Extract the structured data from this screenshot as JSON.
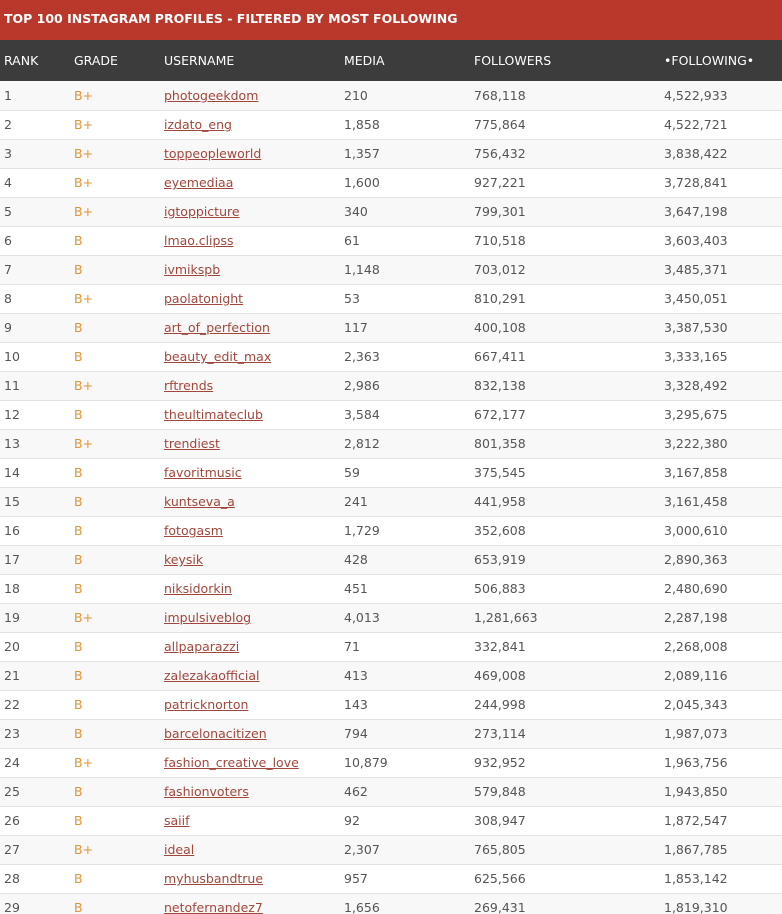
{
  "title": "TOP 100 INSTAGRAM PROFILES - FILTERED BY MOST FOLLOWING",
  "columns": {
    "rank": "RANK",
    "grade": "GRADE",
    "username": "USERNAME",
    "media": "MEDIA",
    "followers": "FOLLOWERS",
    "following": "•FOLLOWING•"
  },
  "colors": {
    "title_bar": "#b9372b",
    "header_bar": "#3c3c3c",
    "grade_text": "#e0953a",
    "username_link": "#a2473c"
  },
  "rows": [
    {
      "rank": "1",
      "grade": "B+",
      "username": "photogeekdom",
      "media": "210",
      "followers": "768,118",
      "following": "4,522,933"
    },
    {
      "rank": "2",
      "grade": "B+",
      "username": "izdato_eng",
      "media": "1,858",
      "followers": "775,864",
      "following": "4,522,721"
    },
    {
      "rank": "3",
      "grade": "B+",
      "username": "toppeopleworld",
      "media": "1,357",
      "followers": "756,432",
      "following": "3,838,422"
    },
    {
      "rank": "4",
      "grade": "B+",
      "username": "eyemediaa",
      "media": "1,600",
      "followers": "927,221",
      "following": "3,728,841"
    },
    {
      "rank": "5",
      "grade": "B+",
      "username": "igtoppicture",
      "media": "340",
      "followers": "799,301",
      "following": "3,647,198"
    },
    {
      "rank": "6",
      "grade": "B",
      "username": "lmao.clipss",
      "media": "61",
      "followers": "710,518",
      "following": "3,603,403"
    },
    {
      "rank": "7",
      "grade": "B",
      "username": "ivmikspb",
      "media": "1,148",
      "followers": "703,012",
      "following": "3,485,371"
    },
    {
      "rank": "8",
      "grade": "B+",
      "username": "paolatonight",
      "media": "53",
      "followers": "810,291",
      "following": "3,450,051"
    },
    {
      "rank": "9",
      "grade": "B",
      "username": "art_of_perfection",
      "media": "117",
      "followers": "400,108",
      "following": "3,387,530"
    },
    {
      "rank": "10",
      "grade": "B",
      "username": "beauty_edit_max",
      "media": "2,363",
      "followers": "667,411",
      "following": "3,333,165"
    },
    {
      "rank": "11",
      "grade": "B+",
      "username": "rftrends",
      "media": "2,986",
      "followers": "832,138",
      "following": "3,328,492"
    },
    {
      "rank": "12",
      "grade": "B",
      "username": "theultimateclub",
      "media": "3,584",
      "followers": "672,177",
      "following": "3,295,675"
    },
    {
      "rank": "13",
      "grade": "B+",
      "username": "trendiest",
      "media": "2,812",
      "followers": "801,358",
      "following": "3,222,380"
    },
    {
      "rank": "14",
      "grade": "B",
      "username": "favoritmusic",
      "media": "59",
      "followers": "375,545",
      "following": "3,167,858"
    },
    {
      "rank": "15",
      "grade": "B",
      "username": "kuntseva_a",
      "media": "241",
      "followers": "441,958",
      "following": "3,161,458"
    },
    {
      "rank": "16",
      "grade": "B",
      "username": "fotogasm",
      "media": "1,729",
      "followers": "352,608",
      "following": "3,000,610"
    },
    {
      "rank": "17",
      "grade": "B",
      "username": "keysik",
      "media": "428",
      "followers": "653,919",
      "following": "2,890,363"
    },
    {
      "rank": "18",
      "grade": "B",
      "username": "niksidorkin",
      "media": "451",
      "followers": "506,883",
      "following": "2,480,690"
    },
    {
      "rank": "19",
      "grade": "B+",
      "username": "impulsiveblog",
      "media": "4,013",
      "followers": "1,281,663",
      "following": "2,287,198"
    },
    {
      "rank": "20",
      "grade": "B",
      "username": "allpaparazzi",
      "media": "71",
      "followers": "332,841",
      "following": "2,268,008"
    },
    {
      "rank": "21",
      "grade": "B",
      "username": "zalezakaofficial",
      "media": "413",
      "followers": "469,008",
      "following": "2,089,116"
    },
    {
      "rank": "22",
      "grade": "B",
      "username": "patricknorton",
      "media": "143",
      "followers": "244,998",
      "following": "2,045,343"
    },
    {
      "rank": "23",
      "grade": "B",
      "username": "barcelonacitizen",
      "media": "794",
      "followers": "273,114",
      "following": "1,987,073"
    },
    {
      "rank": "24",
      "grade": "B+",
      "username": "fashion_creative_love",
      "media": "10,879",
      "followers": "932,952",
      "following": "1,963,756"
    },
    {
      "rank": "25",
      "grade": "B",
      "username": "fashionvoters",
      "media": "462",
      "followers": "579,848",
      "following": "1,943,850"
    },
    {
      "rank": "26",
      "grade": "B",
      "username": "saiif",
      "media": "92",
      "followers": "308,947",
      "following": "1,872,547"
    },
    {
      "rank": "27",
      "grade": "B+",
      "username": "ideal",
      "media": "2,307",
      "followers": "765,805",
      "following": "1,867,785"
    },
    {
      "rank": "28",
      "grade": "B",
      "username": "myhusbandtrue",
      "media": "957",
      "followers": "625,566",
      "following": "1,853,142"
    },
    {
      "rank": "29",
      "grade": "B",
      "username": "netofernandez7",
      "media": "1,656",
      "followers": "269,431",
      "following": "1,819,310"
    }
  ]
}
